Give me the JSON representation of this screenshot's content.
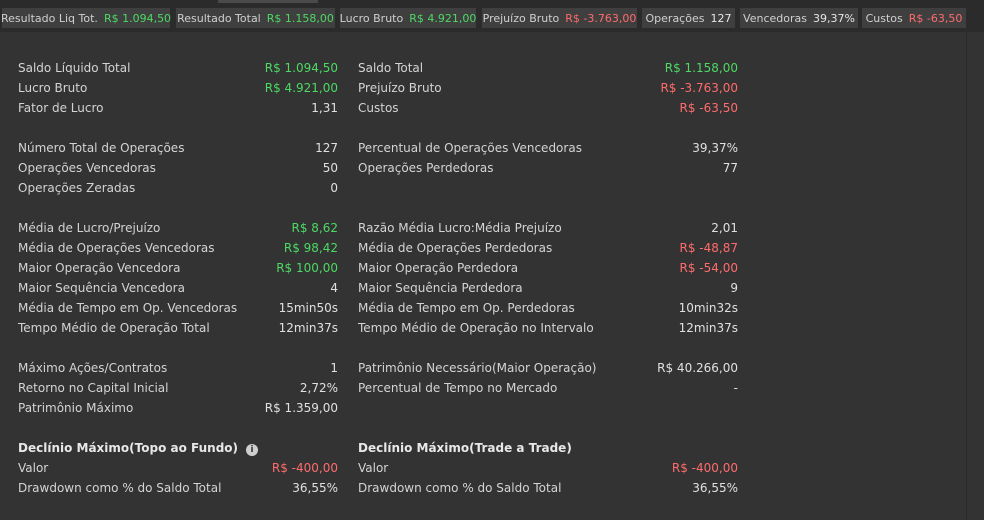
{
  "chips": [
    {
      "label": "Resultado Liq Tot.",
      "value": "R$ 1.094,50",
      "tone": "pos"
    },
    {
      "label": "Resultado Total",
      "value": "R$ 1.158,00",
      "tone": "pos"
    },
    {
      "label": "Lucro Bruto",
      "value": "R$ 4.921,00",
      "tone": "pos"
    },
    {
      "label": "Prejuízo Bruto",
      "value": "R$ -3.763,00",
      "tone": "neg"
    },
    {
      "label": "Operações",
      "value": "127",
      "tone": ""
    },
    {
      "label": "Vencedoras",
      "value": "39,37%",
      "tone": ""
    },
    {
      "label": "Custos",
      "value": "R$ -63,50",
      "tone": "neg"
    }
  ],
  "left": [
    {
      "label": "Saldo Líquido Total",
      "value": "R$ 1.094,50",
      "tone": "pos"
    },
    {
      "label": "Lucro Bruto",
      "value": "R$ 4.921,00",
      "tone": "pos"
    },
    {
      "label": "Fator de Lucro",
      "value": "1,31",
      "tone": ""
    },
    {
      "label": "Número Total de Operações",
      "value": "127",
      "tone": ""
    },
    {
      "label": "Operações Vencedoras",
      "value": "50",
      "tone": ""
    },
    {
      "label": "Operações Zeradas",
      "value": "0",
      "tone": ""
    },
    {
      "label": "Média de Lucro/Prejuízo",
      "value": "R$ 8,62",
      "tone": "pos"
    },
    {
      "label": "Média de Operações Vencedoras",
      "value": "R$ 98,42",
      "tone": "pos"
    },
    {
      "label": "Maior Operação Vencedora",
      "value": "R$ 100,00",
      "tone": "pos"
    },
    {
      "label": "Maior Sequência Vencedora",
      "value": "4",
      "tone": ""
    },
    {
      "label": "Média de Tempo em Op. Vencedoras",
      "value": "15min50s",
      "tone": ""
    },
    {
      "label": "Tempo Médio de Operação Total",
      "value": "12min37s",
      "tone": ""
    },
    {
      "label": "Máximo Ações/Contratos",
      "value": "1",
      "tone": ""
    },
    {
      "label": "Retorno no Capital Inicial",
      "value": "2,72%",
      "tone": ""
    },
    {
      "label": "Patrimônio Máximo",
      "value": "R$ 1.359,00",
      "tone": ""
    }
  ],
  "right": [
    {
      "label": "Saldo Total",
      "value": "R$ 1.158,00",
      "tone": "pos"
    },
    {
      "label": "Prejuízo Bruto",
      "value": "R$ -3.763,00",
      "tone": "neg"
    },
    {
      "label": "Custos",
      "value": "R$ -63,50",
      "tone": "neg"
    },
    {
      "label": "Percentual de Operações Vencedoras",
      "value": "39,37%",
      "tone": ""
    },
    {
      "label": "Operações Perdedoras",
      "value": "77",
      "tone": ""
    },
    {
      "label": "Razão Média Lucro:Média Prejuízo",
      "value": "2,01",
      "tone": ""
    },
    {
      "label": "Média de Operações Perdedoras",
      "value": "R$ -48,87",
      "tone": "neg"
    },
    {
      "label": "Maior Operação Perdedora",
      "value": "R$ -54,00",
      "tone": "neg"
    },
    {
      "label": "Maior Sequência Perdedora",
      "value": "9",
      "tone": ""
    },
    {
      "label": "Média de Tempo em Op. Perdedoras",
      "value": "10min32s",
      "tone": ""
    },
    {
      "label": "Tempo Médio de Operação no Intervalo",
      "value": "12min37s",
      "tone": ""
    },
    {
      "label": "Patrimônio Necessário(Maior Operação)",
      "value": "R$ 40.266,00",
      "tone": ""
    },
    {
      "label": "Percentual de Tempo no Mercado",
      "value": "-",
      "tone": ""
    }
  ],
  "drawdown_left": {
    "title": "Declínio Máximo(Topo ao Fundo)",
    "info_icon": "i",
    "rows": [
      {
        "label": "Valor",
        "value": "R$ -400,00",
        "tone": "neg"
      },
      {
        "label": "Drawdown como % do Saldo Total",
        "value": "36,55%",
        "tone": ""
      }
    ]
  },
  "drawdown_right": {
    "title": "Declínio Máximo(Trade a Trade)",
    "rows": [
      {
        "label": "Valor",
        "value": "R$ -400,00",
        "tone": "neg"
      },
      {
        "label": "Drawdown como % do Saldo Total",
        "value": "36,55%",
        "tone": ""
      }
    ]
  },
  "colors": {
    "positive": "#4cd964",
    "negative": "#ff6b6b",
    "background": "#333333"
  }
}
